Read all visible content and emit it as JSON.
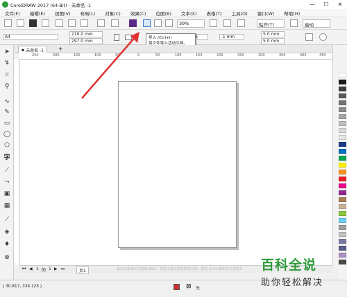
{
  "window": {
    "title": "CorelDRAW 2017 (64-Bit) - 未命名 -1",
    "minimize": "—",
    "maximize": "☐",
    "close": "✕"
  },
  "menu": [
    "文件(F)",
    "编辑(E)",
    "视图(V)",
    "布局(L)",
    "对象(C)",
    "效果(C)",
    "位图(B)",
    "文本(X)",
    "表格(T)",
    "工具(O)",
    "窗口(W)",
    "帮助(H)"
  ],
  "toolbar": {
    "zoom": "39%",
    "snap": "贴齐(T)",
    "launch": "启动"
  },
  "propertybar": {
    "page_size": "A4",
    "width": "210.0 mm",
    "height": "297.0 mm",
    "unit": "毫米",
    "nudge": ".1 mm",
    "dup_x": "5.0 mm",
    "dup_y": "5.0 mm"
  },
  "tooltip": {
    "title": "导入 (Ctrl+I)",
    "desc": "将文件导入活动文档。"
  },
  "tab": {
    "name": "未命名 -1",
    "add": "+"
  },
  "ruler": {
    "labels": [
      "250",
      "200",
      "150",
      "100",
      "50",
      "0",
      "50",
      "100",
      "150",
      "200",
      "250",
      "300",
      "350",
      "400",
      "450"
    ],
    "unit": "毫米"
  },
  "pagenav": {
    "current": "1",
    "of": "的",
    "total": "1",
    "page_tab": "页1"
  },
  "statusbar": {
    "coords": "( 30.817, 334.125 )",
    "fill_label": "无",
    "hint": "单击对象两次可旋转/倾斜；双击工具可选择所有对象；按住 Shift 键单击可选择多个对象；按住 Alt 键单击可进行挖掘；按住 Ctrl 键并单击可在组中选择"
  },
  "watermark": {
    "line1": "百科全说",
    "line2": "助你轻松解决"
  },
  "palette": [
    "#ffffff",
    "#1a1a1a",
    "#3d3d3d",
    "#595959",
    "#737373",
    "#8c8c8c",
    "#a6a6a6",
    "#bfbfbf",
    "#d9d9d9",
    "#e6e6e6",
    "#1d3a8a",
    "#0072bc",
    "#00a651",
    "#fff200",
    "#f7941d",
    "#ed1c24",
    "#ec008c",
    "#92278f",
    "#a67c52",
    "#c7b299",
    "#8dc63f",
    "#6dcff6",
    "#9e9e9e",
    "#c2c2c2",
    "#7a7aa6",
    "#5c5c8a",
    "#ab8fc4",
    "#4a4a4a"
  ],
  "annotation": {
    "arrow_color": "#e03131"
  }
}
